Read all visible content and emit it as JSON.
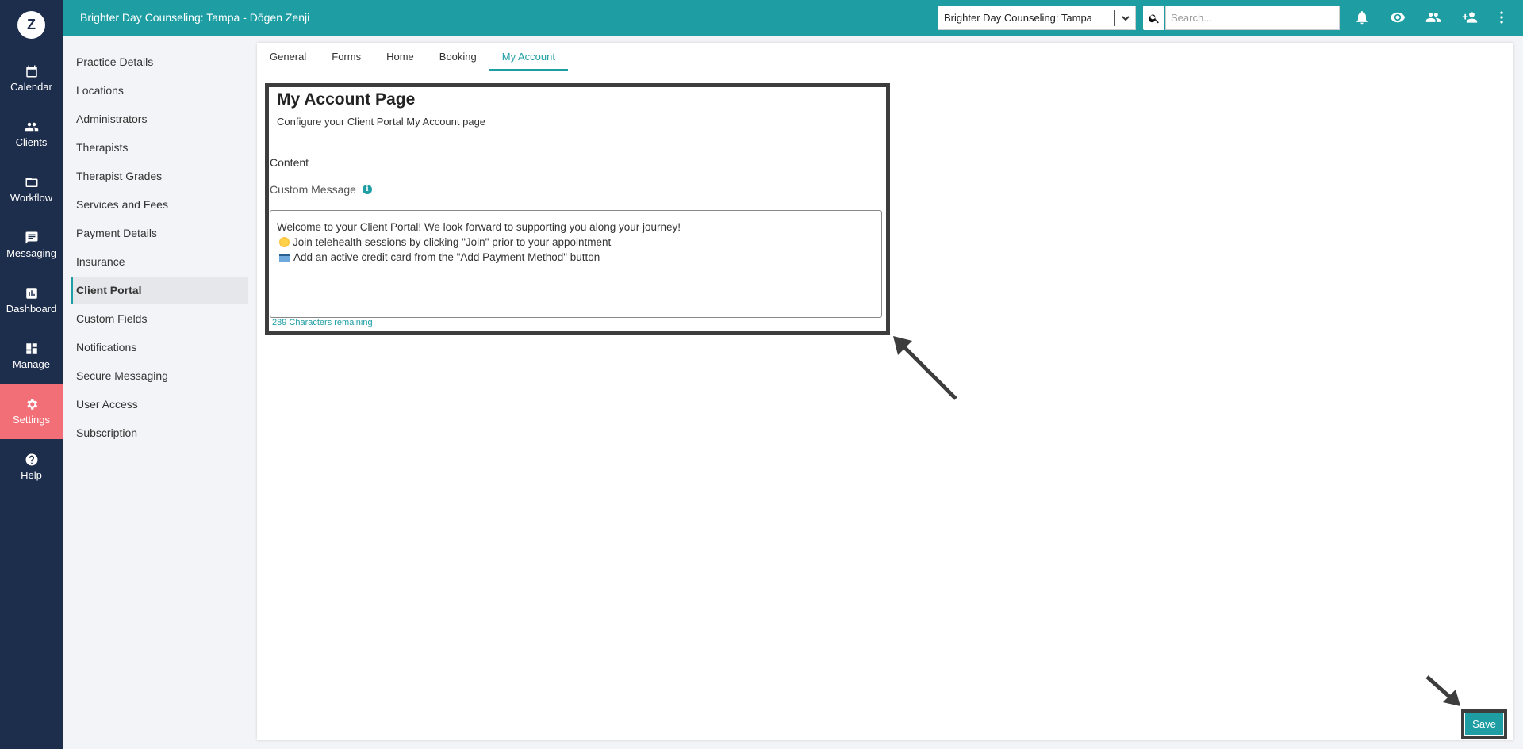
{
  "app": {
    "logo_letter": "Z"
  },
  "topbar": {
    "title": "Brighter Day Counseling: Tampa - Dōgen Zenji",
    "location_select": "Brighter Day Counseling: Tampa",
    "search_placeholder": "Search..."
  },
  "rail": {
    "items": [
      {
        "label": "Calendar",
        "icon": "calendar-icon"
      },
      {
        "label": "Clients",
        "icon": "clients-icon"
      },
      {
        "label": "Workflow",
        "icon": "folder-icon"
      },
      {
        "label": "Messaging",
        "icon": "message-icon"
      },
      {
        "label": "Dashboard",
        "icon": "chart-icon"
      },
      {
        "label": "Manage",
        "icon": "grid-icon"
      },
      {
        "label": "Settings",
        "icon": "gear-icon",
        "active": true
      },
      {
        "label": "Help",
        "icon": "help-icon"
      }
    ]
  },
  "sidebar": {
    "items": [
      "Practice Details",
      "Locations",
      "Administrators",
      "Therapists",
      "Therapist Grades",
      "Services and Fees",
      "Payment Details",
      "Insurance",
      "Client Portal",
      "Custom Fields",
      "Notifications",
      "Secure Messaging",
      "User Access",
      "Subscription"
    ],
    "active_index": 8
  },
  "tabs": [
    "General",
    "Forms",
    "Home",
    "Booking",
    "My Account"
  ],
  "active_tab": 4,
  "main": {
    "title": "My Account Page",
    "subtitle": "Configure your Client Portal My Account page",
    "section": "Content",
    "field_label": "Custom Message",
    "message": {
      "line1": "Welcome to your Client Portal! We look forward to supporting you along your journey!",
      "line2": "Join telehealth sessions by clicking \"Join\" prior to your appointment",
      "line3": "Add an active credit card from the \"Add Payment Method\" button"
    },
    "chars_remaining": "289 Characters remaining"
  },
  "save_label": "Save",
  "colors": {
    "teal": "#1e9ea3",
    "navy": "#1d2d4c",
    "settings_active": "#f36f78"
  }
}
